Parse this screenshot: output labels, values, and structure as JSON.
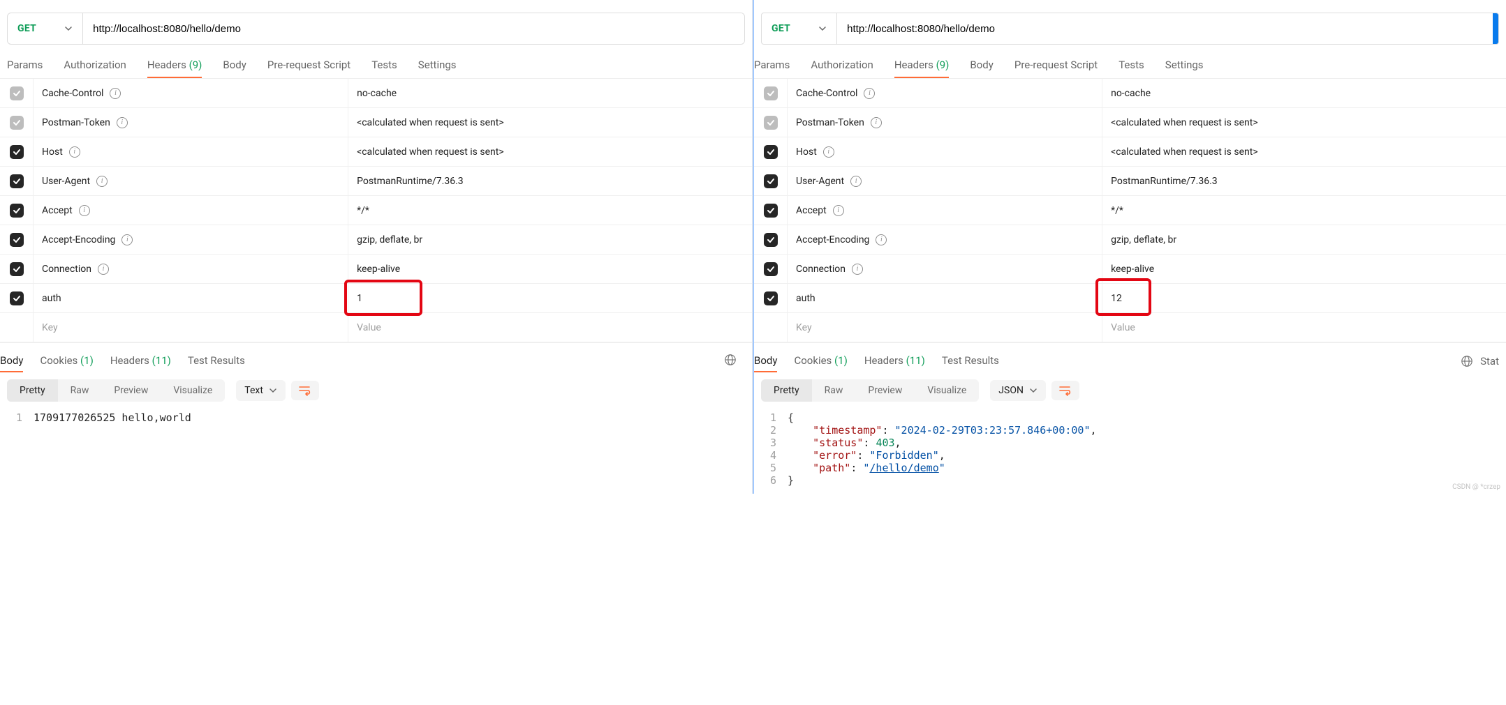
{
  "left": {
    "method": "GET",
    "url": "http://localhost:8080/hello/demo",
    "tabs": [
      "Params",
      "Authorization",
      "Headers",
      "Body",
      "Pre-request Script",
      "Tests",
      "Settings"
    ],
    "active_tab": 2,
    "headers_count": "(9)",
    "headers": [
      {
        "key": "Cache-Control",
        "value": "no-cache",
        "checked": true,
        "locked": true,
        "info": true
      },
      {
        "key": "Postman-Token",
        "value": "<calculated when request is sent>",
        "checked": true,
        "locked": true,
        "info": true
      },
      {
        "key": "Host",
        "value": "<calculated when request is sent>",
        "checked": true,
        "locked": false,
        "info": true
      },
      {
        "key": "User-Agent",
        "value": "PostmanRuntime/7.36.3",
        "checked": true,
        "locked": false,
        "info": true
      },
      {
        "key": "Accept",
        "value": "*/*",
        "checked": true,
        "locked": false,
        "info": true
      },
      {
        "key": "Accept-Encoding",
        "value": "gzip, deflate, br",
        "checked": true,
        "locked": false,
        "info": true
      },
      {
        "key": "Connection",
        "value": "keep-alive",
        "checked": true,
        "locked": false,
        "info": true
      },
      {
        "key": "auth",
        "value": "1",
        "checked": true,
        "locked": false,
        "info": false,
        "highlight": "left"
      }
    ],
    "key_placeholder": "Key",
    "value_placeholder": "Value",
    "response_tabs": {
      "body": "Body",
      "cookies": "Cookies",
      "cookies_count": "(1)",
      "headers": "Headers",
      "headers_count": "(11)",
      "test_results": "Test Results",
      "active": "body"
    },
    "view_tabs": [
      "Pretty",
      "Raw",
      "Preview",
      "Visualize"
    ],
    "view_active": 0,
    "format": "Text",
    "body_lines": [
      {
        "n": "1",
        "raw": "1709177026525 hello,world"
      }
    ]
  },
  "right": {
    "method": "GET",
    "url": "http://localhost:8080/hello/demo",
    "tabs": [
      "Params",
      "Authorization",
      "Headers",
      "Body",
      "Pre-request Script",
      "Tests",
      "Settings"
    ],
    "active_tab": 2,
    "headers_count": "(9)",
    "headers": [
      {
        "key": "Cache-Control",
        "value": "no-cache",
        "checked": true,
        "locked": true,
        "info": true
      },
      {
        "key": "Postman-Token",
        "value": "<calculated when request is sent>",
        "checked": true,
        "locked": true,
        "info": true
      },
      {
        "key": "Host",
        "value": "<calculated when request is sent>",
        "checked": true,
        "locked": false,
        "info": true
      },
      {
        "key": "User-Agent",
        "value": "PostmanRuntime/7.36.3",
        "checked": true,
        "locked": false,
        "info": true
      },
      {
        "key": "Accept",
        "value": "*/*",
        "checked": true,
        "locked": false,
        "info": true
      },
      {
        "key": "Accept-Encoding",
        "value": "gzip, deflate, br",
        "checked": true,
        "locked": false,
        "info": true
      },
      {
        "key": "Connection",
        "value": "keep-alive",
        "checked": true,
        "locked": false,
        "info": true
      },
      {
        "key": "auth",
        "value": "12",
        "checked": true,
        "locked": false,
        "info": false,
        "highlight": "right"
      }
    ],
    "key_placeholder": "Key",
    "value_placeholder": "Value",
    "response_tabs": {
      "body": "Body",
      "cookies": "Cookies",
      "cookies_count": "(1)",
      "headers": "Headers",
      "headers_count": "(11)",
      "test_results": "Test Results",
      "active": "body",
      "status_edge": "Stat"
    },
    "view_tabs": [
      "Pretty",
      "Raw",
      "Preview",
      "Visualize"
    ],
    "view_active": 0,
    "format": "JSON",
    "body_json": {
      "timestamp": "2024-02-29T03:23:57.846+00:00",
      "status": 403,
      "error": "Forbidden",
      "path": "/hello/demo"
    },
    "watermark": "CSDN @ *crzep"
  },
  "icons": {
    "check": "✓",
    "info": "i"
  }
}
